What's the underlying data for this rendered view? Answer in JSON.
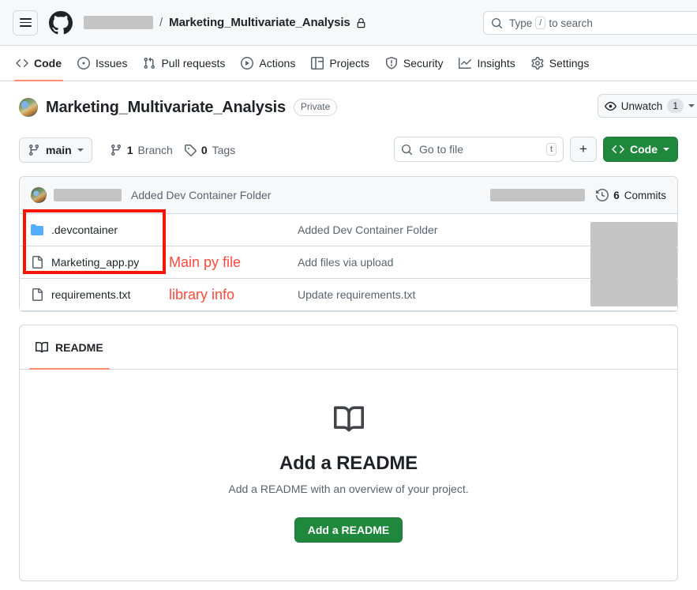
{
  "header": {
    "menu_icon": "hamburger-menu-icon",
    "logo_icon": "github-logo-icon",
    "owner_redacted": "",
    "separator": "/",
    "repo_name": "Marketing_Multivariate_Analysis",
    "lock_icon": "lock-icon",
    "search_icon": "search-icon",
    "search_placeholder_prefix": "Type",
    "search_key_hint": "/",
    "search_placeholder_suffix": "to search"
  },
  "nav": {
    "tabs": [
      {
        "label": "Code",
        "icon": "code-icon",
        "active": true
      },
      {
        "label": "Issues",
        "icon": "issue-opened-icon",
        "active": false
      },
      {
        "label": "Pull requests",
        "icon": "git-pull-request-icon",
        "active": false
      },
      {
        "label": "Actions",
        "icon": "play-icon",
        "active": false
      },
      {
        "label": "Projects",
        "icon": "table-icon",
        "active": false
      },
      {
        "label": "Security",
        "icon": "shield-icon",
        "active": false
      },
      {
        "label": "Insights",
        "icon": "graph-icon",
        "active": false
      },
      {
        "label": "Settings",
        "icon": "gear-icon",
        "active": false
      }
    ]
  },
  "repo": {
    "title": "Marketing_Multivariate_Analysis",
    "visibility_badge": "Private",
    "watch_label": "Unwatch",
    "watch_count": "1",
    "watch_icon": "eye-icon"
  },
  "toolbar": {
    "branch_icon": "git-branch-icon",
    "branch_name": "main",
    "branches_count": "1",
    "branches_label": "Branch",
    "tags_icon": "tag-icon",
    "tags_count": "0",
    "tags_label": "Tags",
    "gotofile_placeholder": "Go to file",
    "gotofile_key_hint": "t",
    "add_label": "+",
    "code_label": "Code"
  },
  "commit_bar": {
    "author_redacted": "",
    "message": "Added Dev Container Folder",
    "time_redacted": "",
    "commits_icon": "history-icon",
    "commits_count": "6",
    "commits_label": "Commits"
  },
  "files": [
    {
      "icon": "folder-icon",
      "name": ".devcontainer",
      "annotation": "",
      "message": "Added Dev Container Folder",
      "time_redacted": ""
    },
    {
      "icon": "file-icon",
      "name": "Marketing_app.py",
      "annotation": "Main py file",
      "message": "Add files via upload",
      "time_redacted": ""
    },
    {
      "icon": "file-icon",
      "name": "requirements.txt",
      "annotation": "library info",
      "message": "Update requirements.txt",
      "time_redacted": ""
    }
  ],
  "readme": {
    "tab_label": "README",
    "tab_icon": "book-icon",
    "empty_icon": "book-icon",
    "empty_title": "Add a README",
    "empty_subtitle": "Add a README with an overview of your project.",
    "button_label": "Add a README"
  },
  "colors": {
    "accent_green": "#1f883d",
    "tab_underline": "#fd8c73",
    "annotation_red": "#fc4a3f",
    "annotation_box_red": "#f91505",
    "folder_blue": "#54aeff",
    "muted_text": "#59636e",
    "border": "#d1d9e0",
    "redaction_gray": "#c4c4c4"
  }
}
